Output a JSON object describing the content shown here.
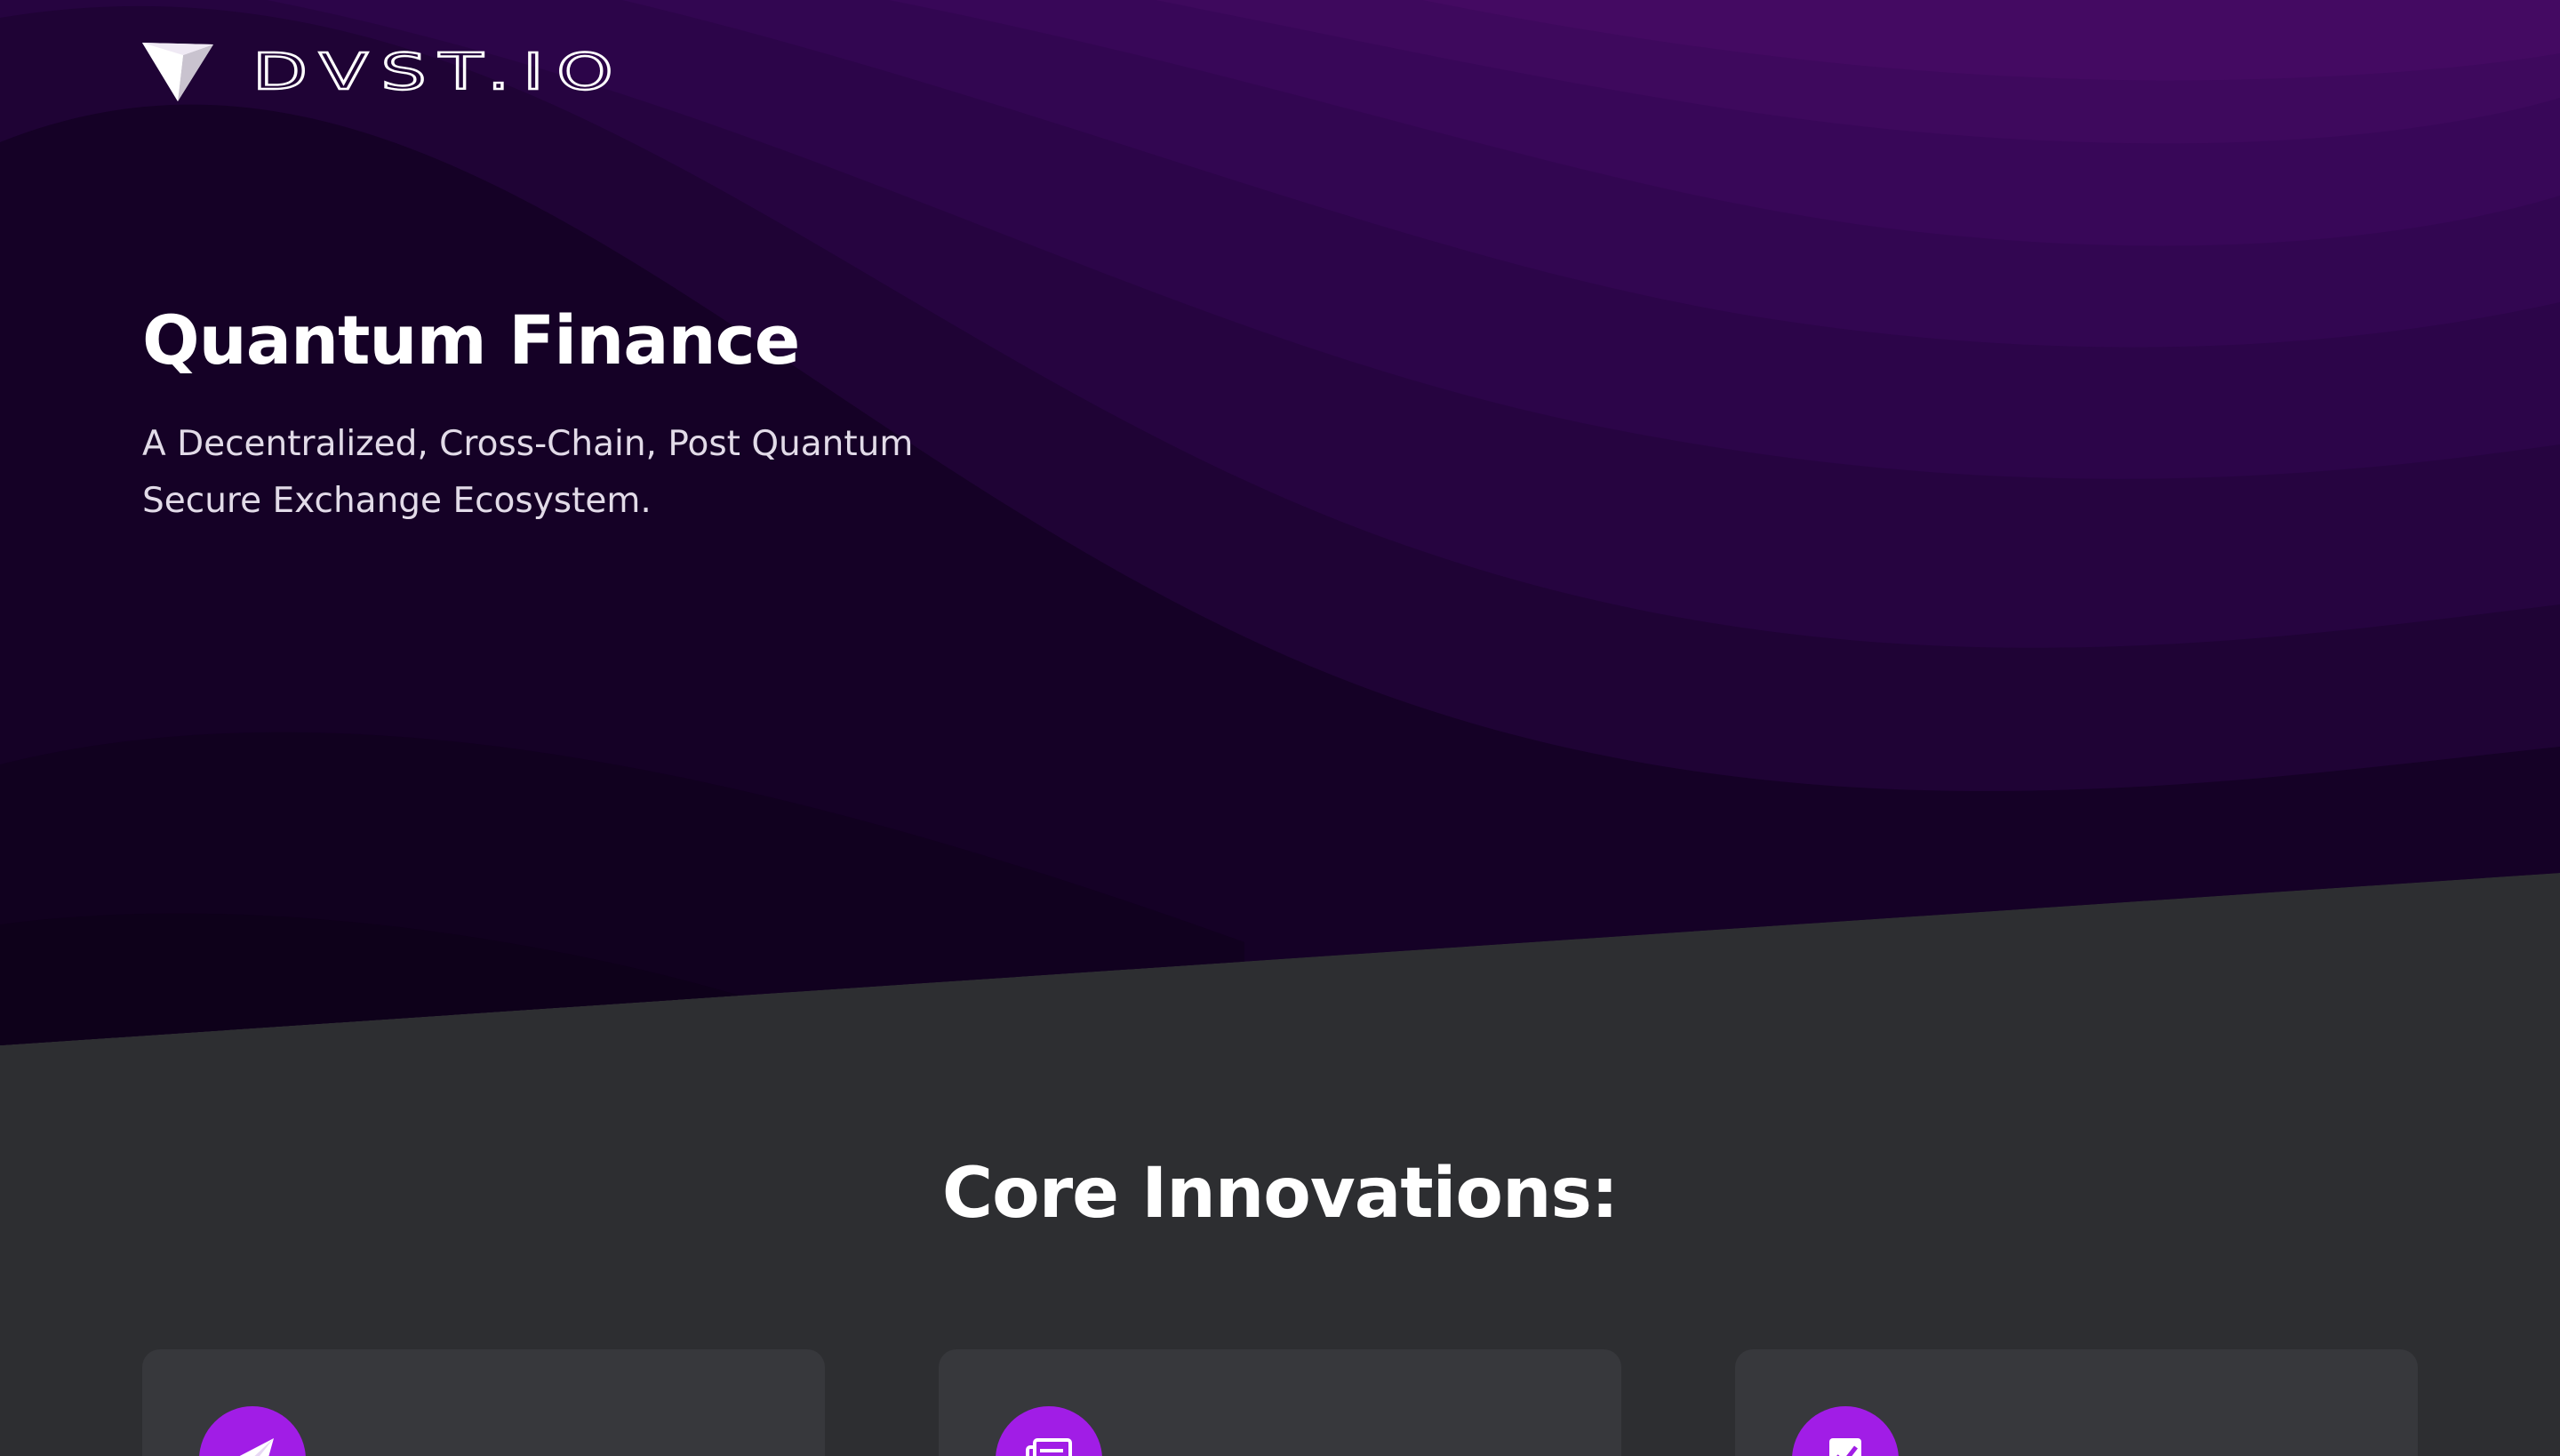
{
  "brand": {
    "name": "DVST.IO"
  },
  "hero": {
    "title": "Quantum Finance",
    "subtitle": "A Decentralized, Cross-Chain, Post Quantum Secure Exchange Ecosystem."
  },
  "core": {
    "title": "Core Innovations:",
    "cards": [
      {
        "icon": "paper-plane-icon"
      },
      {
        "icon": "stacked-documents-icon"
      },
      {
        "icon": "document-check-icon"
      }
    ]
  },
  "colors": {
    "hero_dark": "#140124",
    "hero_light": "#440a5e",
    "section_bg": "#2d2e31",
    "card_bg": "#37383c",
    "accent": "#a11de6"
  }
}
